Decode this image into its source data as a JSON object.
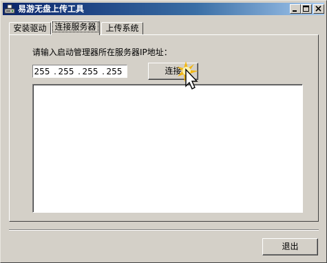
{
  "window": {
    "title": "易游无盘上传工具",
    "icon": "app-drive-icon"
  },
  "caption_buttons": {
    "minimize": "minimize-icon",
    "maximize": "maximize-icon",
    "close": "close-icon"
  },
  "tabs": [
    {
      "label": "安装驱动",
      "selected": false
    },
    {
      "label": "连接服务器",
      "selected": true
    },
    {
      "label": "上传系统",
      "selected": false
    }
  ],
  "connect": {
    "prompt": "请输入启动管理器所在服务器IP地址：",
    "ip": [
      "255",
      "255",
      "255",
      "255"
    ],
    "ip_separator": ".",
    "button_label": "连接",
    "log_text": ""
  },
  "footer": {
    "exit_label": "退出"
  },
  "colors": {
    "face": "#d4d0c8",
    "titlebar_start": "#0a246a",
    "titlebar_end": "#a6caf0",
    "cursor_highlight": "#f5b400"
  }
}
